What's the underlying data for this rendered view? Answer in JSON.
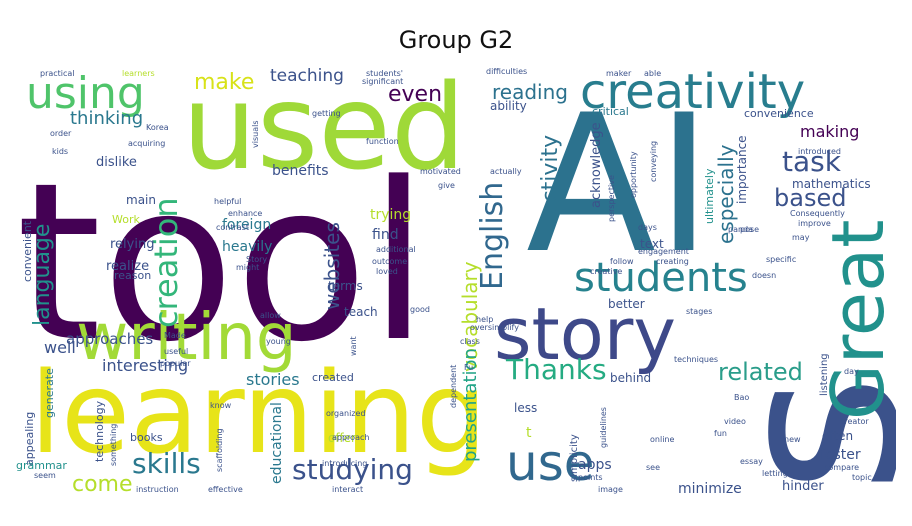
{
  "title": "Group G2",
  "colors": {
    "dark_purple": "#440154",
    "indigo": "#3b528b",
    "teal": "#21918c",
    "green": "#5ec962",
    "yellow_green": "#b5de2b",
    "yellow": "#fde725"
  },
  "words": {
    "tool": "tool",
    "ai": "AI",
    "learning": "learning",
    "used": "used",
    "s": "s",
    "story": "story",
    "writing": "writing",
    "great": "Great",
    "creativity": "creativity",
    "using": "using",
    "students": "students",
    "use": "use",
    "creation": "creation",
    "task": "task",
    "english": "English",
    "thanks": "Thanks",
    "studying": "studying",
    "skills": "skills",
    "activity": "activity",
    "related": "related",
    "make": "make",
    "teaching": "teaching",
    "even": "even",
    "reading": "reading",
    "based": "based",
    "language": "language",
    "websites": "websites",
    "vocabulary": "vocabulary",
    "presentation": "presentation",
    "thinking": "thinking",
    "especially": "especially",
    "come": "come",
    "making": "making",
    "interesting": "interesting",
    "stories": "stories",
    "approaches": "approaches",
    "well": "well",
    "educational": "educational",
    "mathematics": "mathematics",
    "ultimately": "ultimately",
    "acknowledge": "acknowledge",
    "importance": "importance",
    "foster": "foster",
    "hinder": "hinder",
    "minimize": "minimize",
    "apps": "apps",
    "benefits": "benefits",
    "main": "main",
    "foreign": "foreign",
    "heavily": "heavily",
    "trying": "trying",
    "find": "find",
    "dislike": "dislike",
    "relying": "relying",
    "realize": "realize",
    "reason": "reason",
    "convenient": "convenient",
    "technology": "technology",
    "generate": "generate",
    "appealing": "appealing",
    "grammar": "grammar",
    "books": "books",
    "offer": "offer",
    "created": "created",
    "teach": "teach",
    "terms": "terms",
    "better": "better",
    "text": "text",
    "ability": "ability",
    "critical": "critical",
    "convenience": "convenience",
    "listening": "listening",
    "often": "often",
    "behind": "behind",
    "less": "less",
    "simplicity": "simplicity",
    "t": "t",
    "work": "Work",
    "practical": "practical",
    "learners": "learners",
    "significant": "significant",
    "students_apos": "students'",
    "difficulties": "difficulties",
    "maker": "maker",
    "able": "able",
    "getting": "getting",
    "acquiring": "acquiring",
    "korea": "Korea",
    "kids": "kids",
    "order": "order",
    "function": "function",
    "visuals": "visuals",
    "helpful": "helpful",
    "enhance": "enhance",
    "contrast": "contrast",
    "story2": "Story",
    "might": "might",
    "motivated": "motivated",
    "give": "give",
    "additional": "additional",
    "outcome": "outcome",
    "loved": "loved",
    "perspective": "perspective",
    "follow": "follow",
    "engagement": "engagement",
    "creating": "creating",
    "creative": "creative",
    "days": "days",
    "pose": "pose",
    "introduced": "introduced",
    "conveying": "conveying",
    "opportunity": "opportunity",
    "improve": "improve",
    "consequently": "Consequently",
    "may": "may",
    "specific": "specific",
    "doesn": "doesn",
    "panda": "panda",
    "actually": "actually",
    "stages": "stages",
    "techniques": "techniques",
    "oversimplify": "oversimplify",
    "help": "help",
    "class": "class",
    "good": "good",
    "want": "want",
    "allow": "allow",
    "made": "Made",
    "young": "young",
    "popular": "popular",
    "useful": "useful",
    "know": "know",
    "organized": "organized",
    "introducing": "introducing",
    "approach": "approach",
    "something": "something",
    "scaffolding": "scaffolding",
    "instruction": "instruction",
    "effective": "effective",
    "interact": "interact",
    "seem": "seem",
    "dependent": "dependent",
    "fu": "Fu",
    "guidelines": "guidelines",
    "points": "points",
    "image": "image",
    "online": "online",
    "video": "video",
    "fun": "fun",
    "essay": "essay",
    "letting": "letting",
    "new": "new",
    "creator": "creator",
    "compare": "compare",
    "topic": "topic",
    "see": "see",
    "bao": "Bao",
    "day": "day"
  }
}
